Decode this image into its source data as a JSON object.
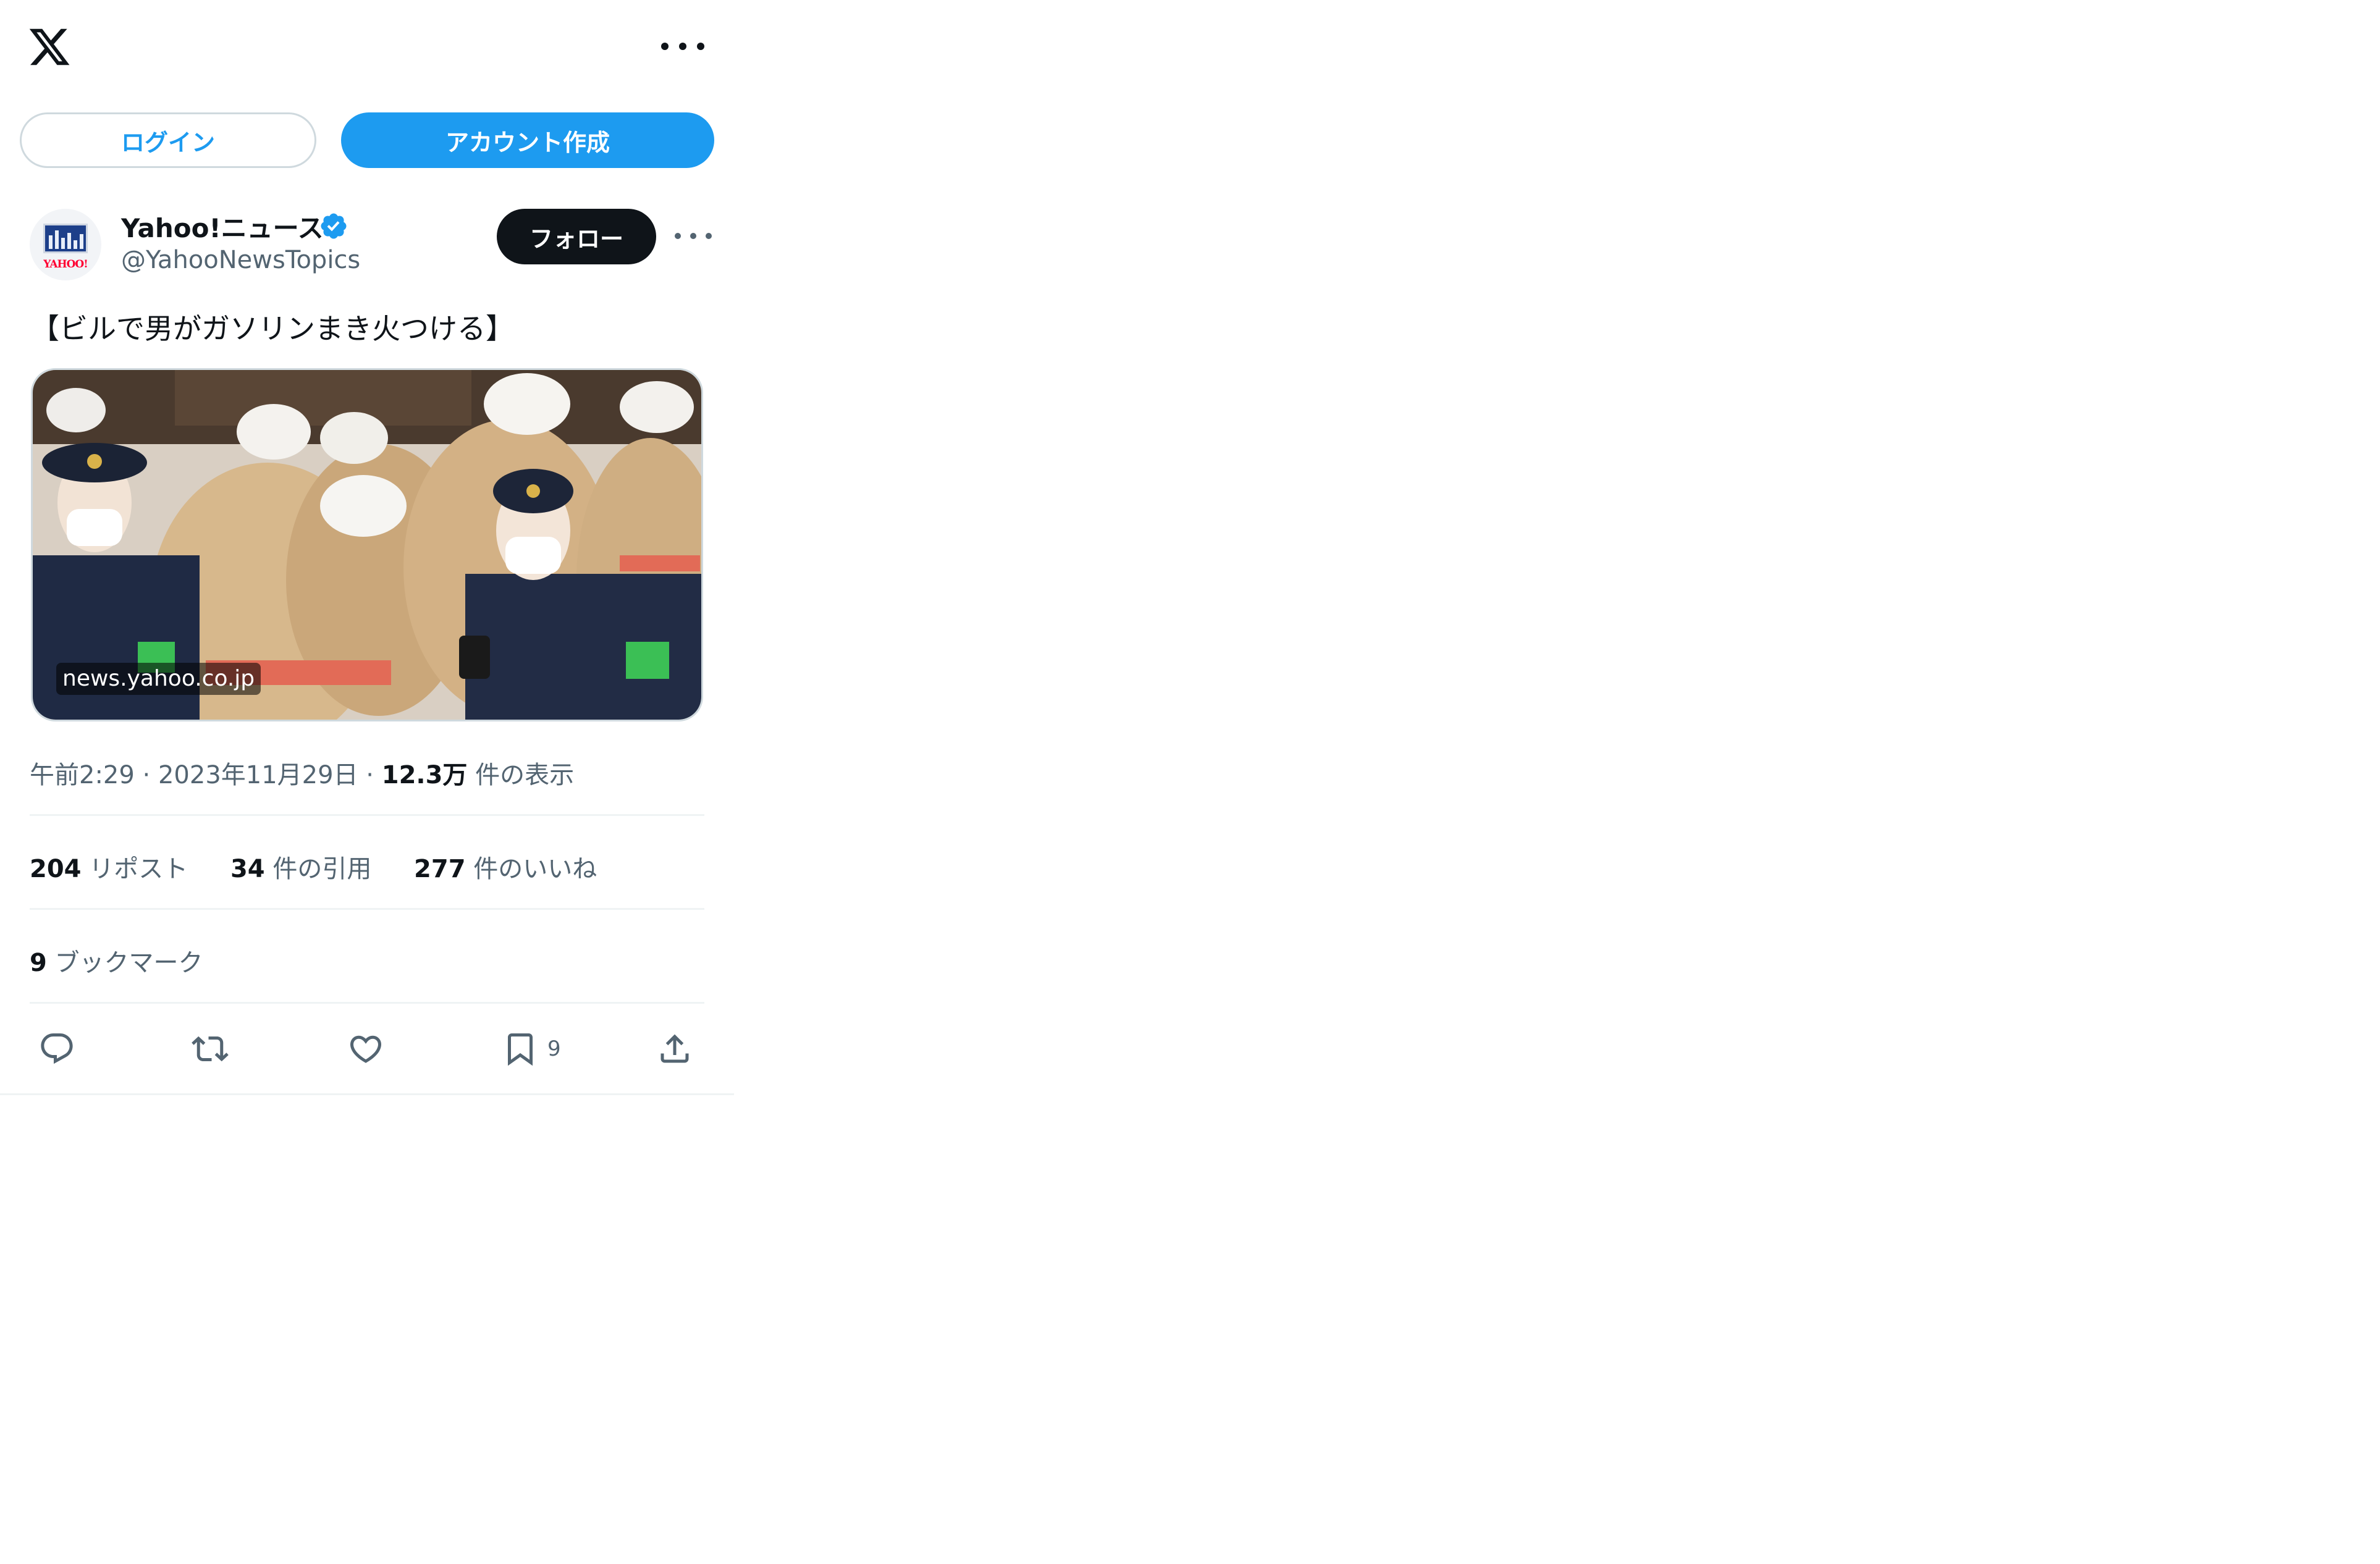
{
  "topbar": {
    "logo": "x-logo",
    "more": "more-icon"
  },
  "auth": {
    "login_label": "ログイン",
    "signup_label": "アカウント作成",
    "accent": "#1d9bf0"
  },
  "tweet": {
    "author": {
      "name": "Yahoo!ニュース",
      "handle": "@YahooNewsTopics",
      "avatar_text": "YAHOO!",
      "verified": true,
      "follow_label": "フォロー"
    },
    "text": "【ビルで男がガソリンまき火つける】",
    "media": {
      "domain": "news.yahoo.co.jp"
    },
    "meta": {
      "time": "午前2:29",
      "separator": "·",
      "date": "2023年11月29日",
      "views_count": "12.3万",
      "views_label": "件の表示"
    },
    "stats": [
      {
        "count": "204",
        "label": "リポスト"
      },
      {
        "count": "34",
        "label": "件の引用"
      },
      {
        "count": "277",
        "label": "件のいいね"
      }
    ],
    "bookmarks": {
      "count": "9",
      "label": "ブックマーク"
    },
    "actions": {
      "reply": "reply-icon",
      "retweet": "retweet-icon",
      "like": "heart-icon",
      "bookmark": "bookmark-icon",
      "bookmark_count": "9",
      "share": "share-icon"
    }
  }
}
